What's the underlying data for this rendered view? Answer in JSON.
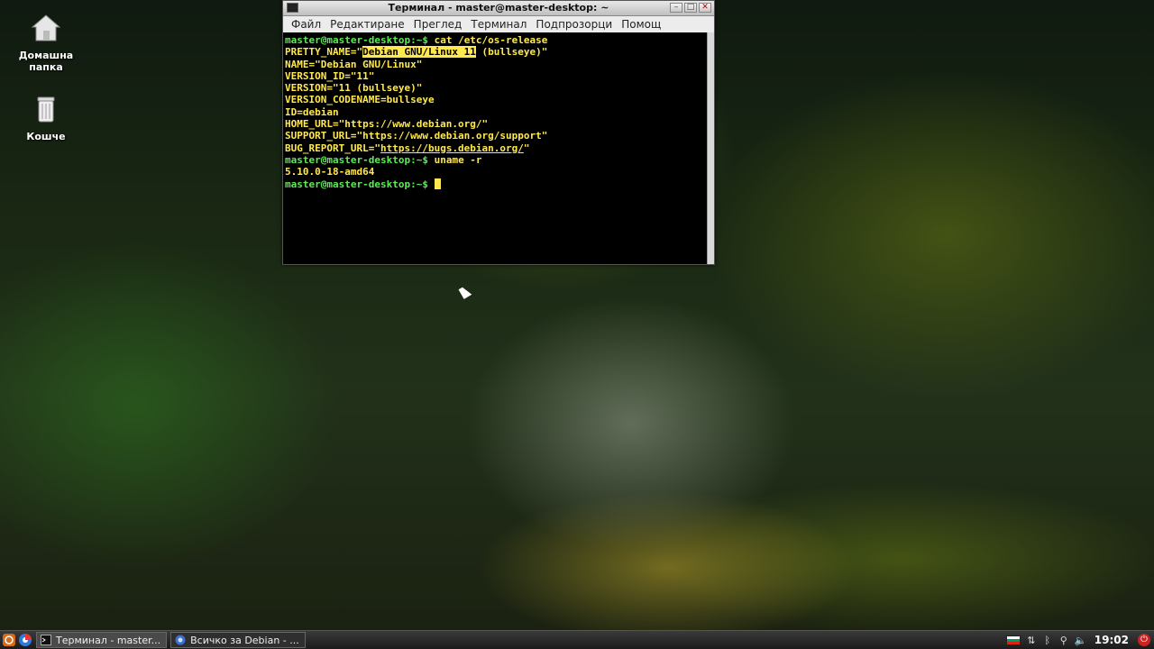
{
  "desktop": {
    "icons": [
      {
        "label_line1": "Домашна",
        "label_line2": "папка",
        "icon": "home-folder-icon"
      },
      {
        "label_line1": "Кошче",
        "label_line2": "",
        "icon": "trash-icon"
      }
    ]
  },
  "terminal": {
    "title": "Терминал - master@master-desktop: ~",
    "menu": [
      "Файл",
      "Редактиране",
      "Преглед",
      "Терминал",
      "Подпрозорци",
      "Помощ"
    ],
    "prompt": "master@master-desktop:~$",
    "lines": {
      "cmd1": " cat /etc/os-release",
      "pretty_prefix": "PRETTY_NAME=\"",
      "pretty_selected": "Debian GNU/Linux 11",
      "pretty_suffix": " (bullseye)\"",
      "name": "NAME=\"Debian GNU/Linux\"",
      "version_id": "VERSION_ID=\"11\"",
      "version": "VERSION=\"11 (bullseye)\"",
      "codename": "VERSION_CODENAME=bullseye",
      "id": "ID=debian",
      "home_url": "HOME_URL=\"https://www.debian.org/\"",
      "support_url": "SUPPORT_URL=\"https://www.debian.org/support\"",
      "bug_prefix": "BUG_REPORT_URL=\"",
      "bug_link": "https://bugs.debian.org/",
      "bug_suffix": "\"",
      "cmd2": " uname -r",
      "kernel": "5.10.0-18-amd64"
    }
  },
  "taskbar": {
    "tasks": [
      {
        "label": "Терминал - master...",
        "icon": "terminal-icon"
      },
      {
        "label": "Всичко за Debian - ...",
        "icon": "browser-icon"
      }
    ],
    "clock": "19:02",
    "colors": {
      "prompt": "#5eea56",
      "text": "#ffe94f"
    }
  }
}
